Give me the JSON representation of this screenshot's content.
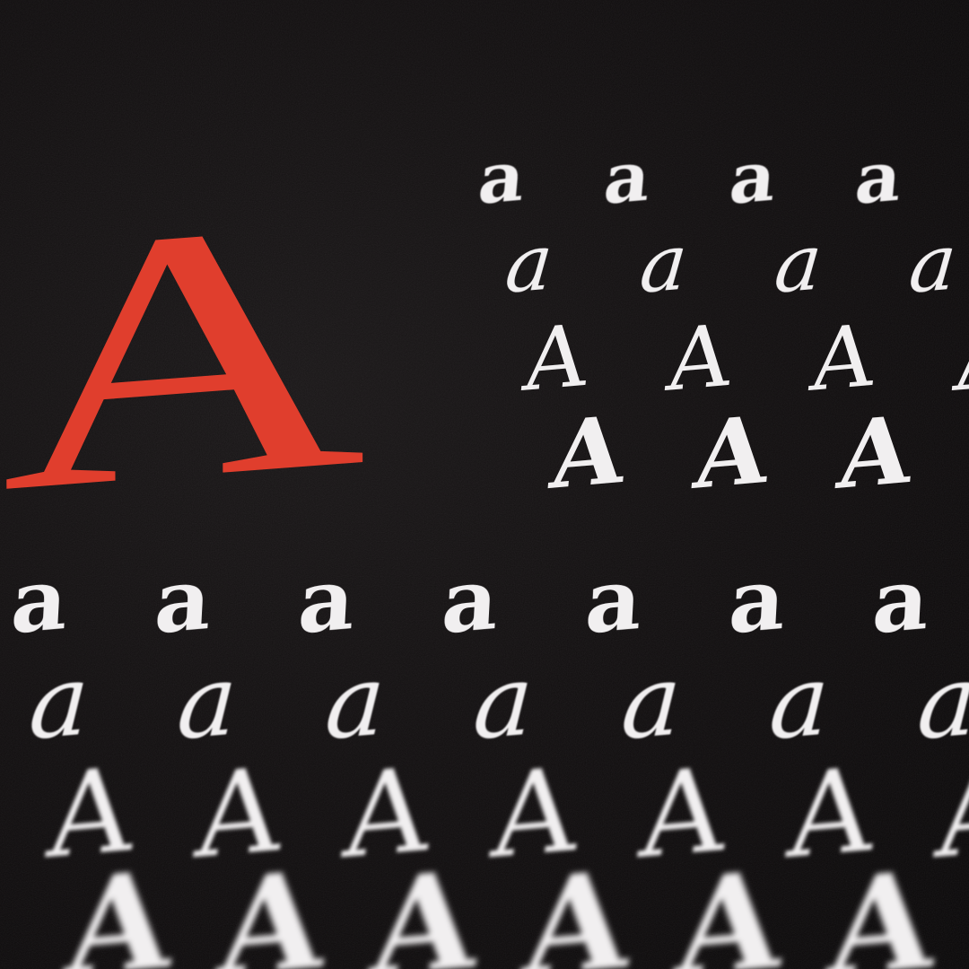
{
  "colors": {
    "background": "#0d0b0c",
    "accent": "#e03e2d",
    "glyph": "#f1eff0"
  },
  "hero_letter": "A",
  "rows": [
    {
      "style": "roman-bold-lower",
      "glyph": "a",
      "count": 4
    },
    {
      "style": "italic-lower",
      "glyph": "a",
      "count": 4
    },
    {
      "style": "roman-upper",
      "glyph": "A",
      "count": 4
    },
    {
      "style": "bold-upper",
      "glyph": "A",
      "count": 4
    },
    {
      "style": "roman-bold-lower",
      "glyph": "a",
      "count": 7
    },
    {
      "style": "italic-lower",
      "glyph": "a",
      "count": 7
    },
    {
      "style": "roman-upper",
      "glyph": "A",
      "count": 7
    },
    {
      "style": "bold-upper",
      "glyph": "A",
      "count": 7
    }
  ]
}
